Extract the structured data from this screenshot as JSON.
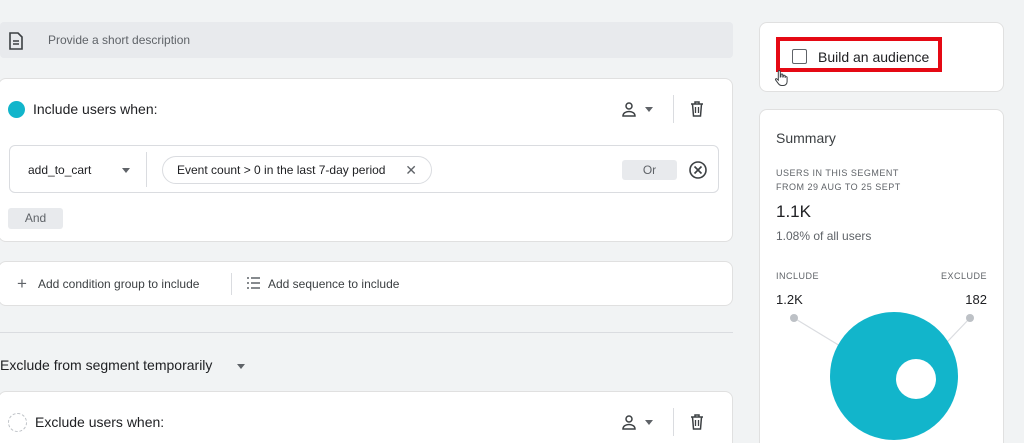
{
  "description": {
    "placeholder": "Provide a short description"
  },
  "include_group": {
    "title": "Include users when:",
    "condition": {
      "event": "add_to_cart",
      "chip_text": "Event count > 0 in the last 7-day period",
      "or_label": "Or"
    },
    "and_label": "And"
  },
  "actions": {
    "add_condition_group": "Add condition group to include",
    "add_sequence": "Add sequence to include"
  },
  "exclude_toggle": {
    "label": "Exclude from segment temporarily"
  },
  "exclude_group": {
    "title": "Exclude users when:"
  },
  "build_audience": {
    "label": "Build an audience",
    "checked": false
  },
  "summary": {
    "title": "Summary",
    "caption_line1": "USERS IN THIS SEGMENT",
    "caption_line2": "FROM 29 AUG TO 25 SEPT",
    "count": "1.1K",
    "percent_text": "1.08% of all users",
    "include_label": "INCLUDE",
    "exclude_label": "EXCLUDE",
    "include_value": "1.2K",
    "exclude_value": "182"
  },
  "colors": {
    "accent": "#12b5cb",
    "highlight": "#e50914"
  }
}
